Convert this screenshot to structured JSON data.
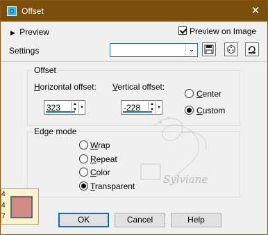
{
  "window": {
    "title": "Offset"
  },
  "header": {
    "preview_label": "Preview",
    "preview_on_image_label": "Preview on Image",
    "preview_on_image_checked": true
  },
  "settings": {
    "label": "Settings",
    "combo_value": ""
  },
  "offset": {
    "group_title": "Offset",
    "h_label_u": "H",
    "h_label_rest": "orizontal offset:",
    "v_label_u": "V",
    "v_label_rest": "ertical offset:",
    "h_value": "323",
    "v_value": "-228",
    "center_u": "C",
    "center_rest": "enter",
    "custom_u": "C",
    "custom_rest": "ustom",
    "selected": "Custom"
  },
  "edge_mode": {
    "group_title": "Edge mode",
    "options": [
      {
        "u": "W",
        "rest": "rap"
      },
      {
        "u": "R",
        "rest": "epeat"
      },
      {
        "u": "C",
        "rest": "olor"
      },
      {
        "u": "T",
        "rest": "ransparent"
      }
    ],
    "selected": "Transparent"
  },
  "swatch": {
    "digits": [
      "4",
      "4",
      "7"
    ],
    "color": "#d08c84"
  },
  "watermark": {
    "text": "Sylviane"
  },
  "buttons": {
    "ok": "OK",
    "cancel": "Cancel",
    "help": "Help"
  },
  "colors": {
    "titlebar": "#7a4e0c",
    "accent": "#0f6cbd"
  }
}
